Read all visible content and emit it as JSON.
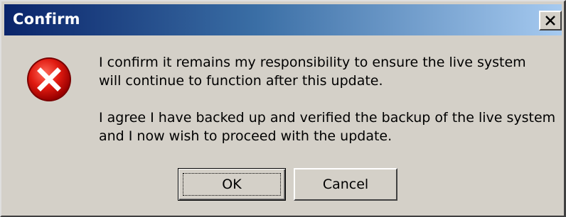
{
  "window": {
    "title": "Confirm",
    "close_glyph": "×"
  },
  "icon": {
    "name": "error-icon",
    "color": "#d40000"
  },
  "message": {
    "paragraph1": [
      "I confirm it remains my responsibility to ensure the live system",
      "will continue to function after this update."
    ],
    "paragraph2": [
      "I agree I have backed up and verified the backup of the live system",
      "and I now wish to proceed with the update."
    ]
  },
  "buttons": {
    "ok_label": "OK",
    "cancel_label": "Cancel"
  },
  "colors": {
    "titlebar_start": "#0a246a",
    "titlebar_end": "#a6caf0",
    "dialog_bg": "#d4d0c8"
  }
}
